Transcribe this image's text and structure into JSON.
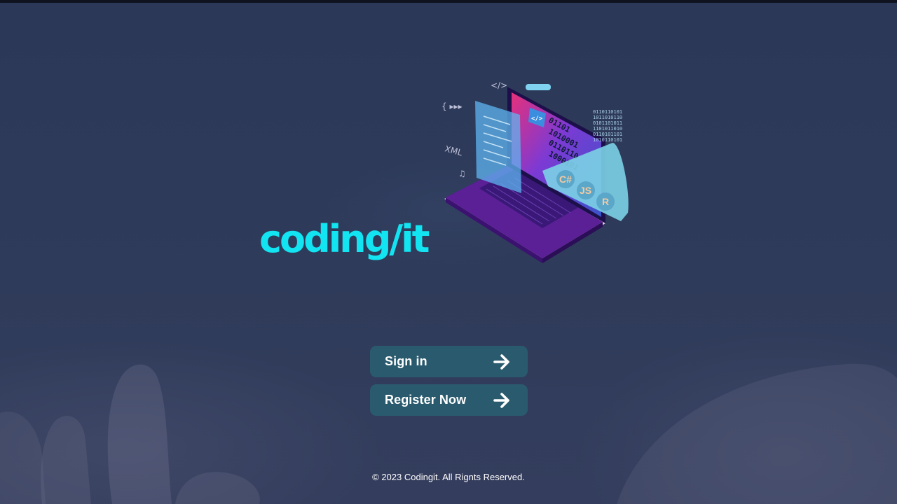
{
  "brand": {
    "logo_text": "coding/it",
    "accent_color": "#12e4f2"
  },
  "hero": {
    "illustration_icon": "laptop-code-illustration-icon",
    "language_chips": [
      "C#",
      "JS",
      "R"
    ]
  },
  "actions": {
    "sign_in_label": "Sign in",
    "register_label": "Register Now",
    "arrow_icon": "arrow-right-icon",
    "button_color": "#2a5a6e"
  },
  "footer": {
    "copyright": "© 2023 Codingit. All Rignts Reserved."
  }
}
